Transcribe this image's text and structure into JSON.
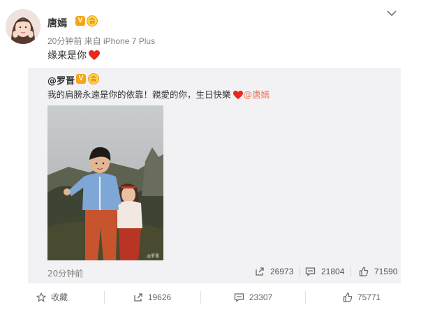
{
  "post": {
    "author": "唐嫣",
    "verified_badge": "V",
    "level_badge": "会",
    "meta": "20分钟前 来自 iPhone 7 Plus",
    "text": "缘来是你",
    "heart_color": "#e8271f"
  },
  "repost": {
    "author": "@罗晋",
    "verified_badge": "V",
    "level_badge": "会",
    "text": "我的肩膀永遠是你的依靠！親愛的你，生日快樂",
    "mention": "@唐嫣",
    "time": "20分钟前",
    "stats": {
      "reposts": "26973",
      "comments": "21804",
      "likes": "71590"
    }
  },
  "actions": {
    "favorite": "收藏",
    "reposts": "19626",
    "comments": "23307",
    "likes": "75771"
  },
  "colors": {
    "link": "#eb7350",
    "badge_orange": "#f6a51a",
    "repost_bg": "#f2f2f5"
  },
  "icons": [
    "chevron-down-icon",
    "repost-icon",
    "comment-icon",
    "like-icon",
    "star-icon",
    "heart-icon"
  ]
}
